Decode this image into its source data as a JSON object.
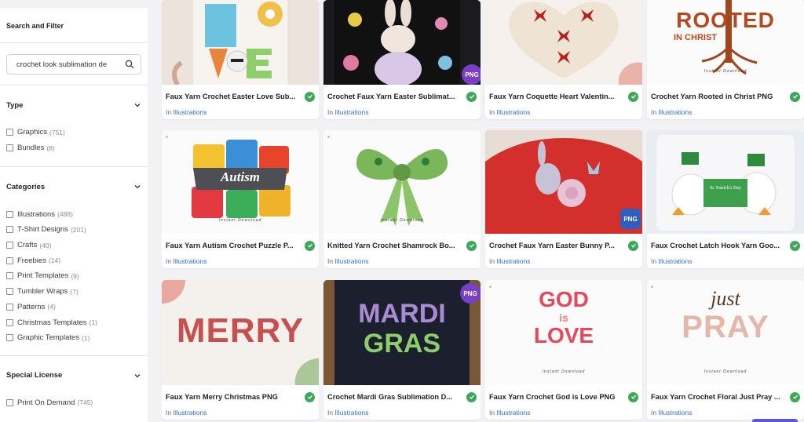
{
  "sidebar": {
    "header": "Search and Filter",
    "search": {
      "value": "crochet look sublimation de"
    },
    "sections": {
      "type": {
        "title": "Type",
        "options": [
          {
            "label": "Graphics",
            "count": "(751)"
          },
          {
            "label": "Bundles",
            "count": "(8)"
          }
        ]
      },
      "categories": {
        "title": "Categories",
        "options": [
          {
            "label": "Illustrations",
            "count": "(488)"
          },
          {
            "label": "T-Shirt Designs",
            "count": "(201)"
          },
          {
            "label": "Crafts",
            "count": "(40)"
          },
          {
            "label": "Freebies",
            "count": "(14)"
          },
          {
            "label": "Print Templates",
            "count": "(9)"
          },
          {
            "label": "Tumbler Wraps",
            "count": "(7)"
          },
          {
            "label": "Patterns",
            "count": "(4)"
          },
          {
            "label": "Christmas Templates",
            "count": "(1)"
          },
          {
            "label": "Graphic Templates",
            "count": "(1)"
          }
        ]
      },
      "special": {
        "title": "Special License",
        "options": [
          {
            "label": "Print On Demand",
            "count": "(745)"
          }
        ]
      }
    }
  },
  "products": [
    {
      "title": "Faux Yarn Crochet Easter Love Sub...",
      "in": "In",
      "category": "Illustrations"
    },
    {
      "title": "Crochet Faux Yarn Easter Sublimat...",
      "in": "In",
      "category": "Illustrations",
      "badge": "PNG"
    },
    {
      "title": "Faux Yarn Coquette Heart Valentin...",
      "in": "In",
      "category": "Illustrations"
    },
    {
      "title": "Crochet Yarn Rooted in Christ PNG",
      "in": "In",
      "category": "Illustrations",
      "art_lines": [
        "ROOTED",
        "IN CHRIST"
      ],
      "instant": "Instant Download"
    },
    {
      "title": "Faux Yarn Autism Crochet Puzzle P...",
      "in": "In",
      "category": "Illustrations",
      "art_lines": [
        "Autism"
      ],
      "instant": "Instant Download"
    },
    {
      "title": "Knitted Yarn Crochet Shamrock Bo...",
      "in": "In",
      "category": "Illustrations",
      "instant": "Instant Download"
    },
    {
      "title": "Crochet Faux Yarn Easter Bunny P...",
      "in": "In",
      "category": "Illustrations",
      "badge": "PNG"
    },
    {
      "title": "Faux Crochet Latch Hook Yarn Goo...",
      "in": "In",
      "category": "Illustrations",
      "art_lines": [
        "St. Patrick's Day"
      ]
    },
    {
      "title": "Faux Yarn Merry Christmas PNG",
      "in": "In",
      "category": "Illustrations",
      "art_lines": [
        "MERRY"
      ]
    },
    {
      "title": "Crochet Mardi Gras Sublimation D...",
      "in": "In",
      "category": "Illustrations",
      "badge": "PNG",
      "art_lines": [
        "MARDI",
        "GRAS"
      ]
    },
    {
      "title": "Faux Yarn Crochet God is Love PNG",
      "in": "In",
      "category": "Illustrations",
      "art_lines": [
        "GOD",
        "is",
        "LOVE"
      ],
      "instant": "Instant Download"
    },
    {
      "title": "Faux Yarn Crochet Floral Just Pray ...",
      "in": "In",
      "category": "Illustrations",
      "art_lines": [
        "just",
        "PRAY"
      ],
      "instant": "Instant Download"
    }
  ],
  "colors": {
    "accent": "#2f6fd1",
    "check": "#3ea85a",
    "badge_purple": "#7a3fc7",
    "badge_blue": "#2e5fc0"
  }
}
